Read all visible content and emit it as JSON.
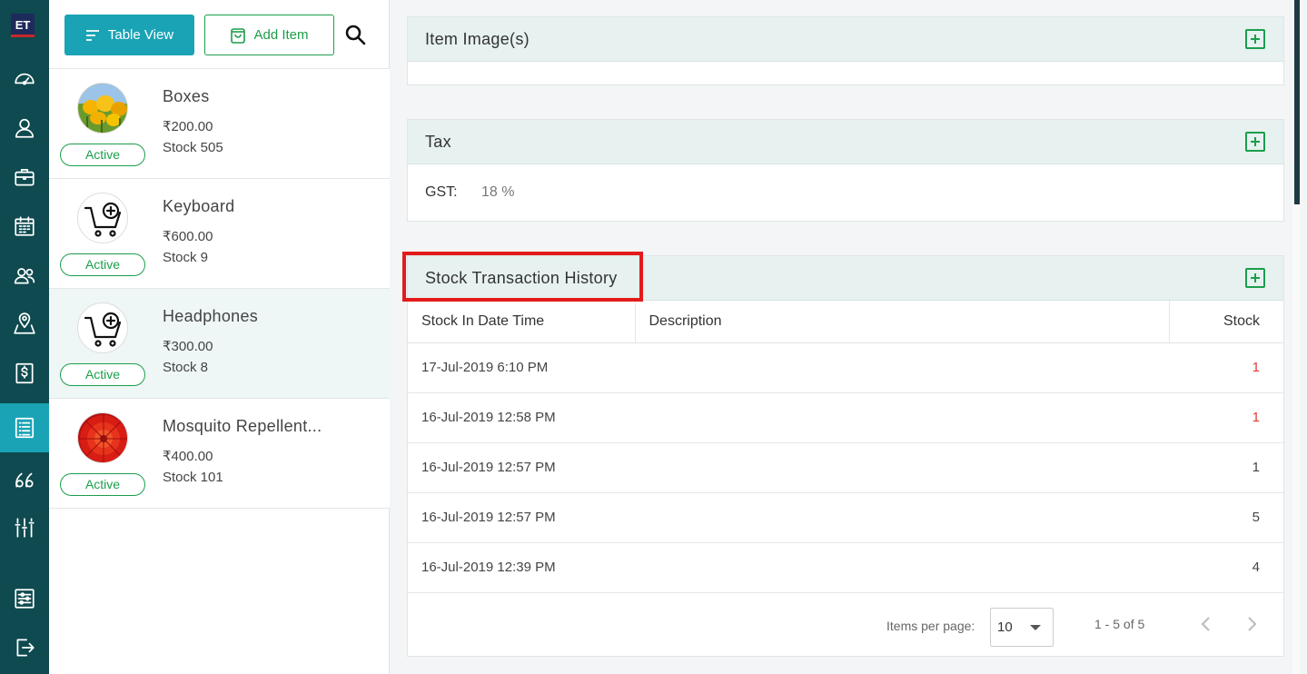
{
  "app": {
    "logo_text": "ET"
  },
  "rail": {
    "items": [
      {
        "icon": "dashboard-icon"
      },
      {
        "icon": "user-icon"
      },
      {
        "icon": "briefcase-icon"
      },
      {
        "icon": "calendar-icon"
      },
      {
        "icon": "users-icon"
      },
      {
        "icon": "map-pin-icon"
      },
      {
        "icon": "dollar-icon"
      },
      {
        "icon": "list-icon",
        "active": true
      },
      {
        "icon": "quote-icon"
      },
      {
        "icon": "sliders-icon"
      },
      {
        "icon": "settings-icon"
      },
      {
        "icon": "logout-icon"
      }
    ]
  },
  "toolbar": {
    "table_view_label": "Table View",
    "add_item_label": "Add Item"
  },
  "items": [
    {
      "name": "Boxes",
      "price": "₹200.00",
      "stock": "Stock 505",
      "status": "Active",
      "thumb": "yellow-flowers"
    },
    {
      "name": "Keyboard",
      "price": "₹600.00",
      "stock": "Stock 9",
      "status": "Active",
      "thumb": "cart"
    },
    {
      "name": "Headphones",
      "price": "₹300.00",
      "stock": "Stock 8",
      "status": "Active",
      "thumb": "cart",
      "selected": true
    },
    {
      "name": "Mosquito Repellent...",
      "price": "₹400.00",
      "stock": "Stock 101",
      "status": "Active",
      "thumb": "red-flower"
    }
  ],
  "sections": {
    "images": {
      "title": "Item Image(s)"
    },
    "tax": {
      "title": "Tax",
      "gst_label": "GST:",
      "gst_value": "18 %"
    },
    "stock": {
      "title": "Stock Transaction History",
      "columns": [
        "Stock In Date Time",
        "Description",
        "Stock"
      ],
      "rows": [
        {
          "datetime": "17-Jul-2019 6:10 PM",
          "description": "",
          "stock": "1",
          "highlight": true
        },
        {
          "datetime": "16-Jul-2019 12:58 PM",
          "description": "",
          "stock": "1",
          "highlight": true
        },
        {
          "datetime": "16-Jul-2019 12:57 PM",
          "description": "",
          "stock": "1"
        },
        {
          "datetime": "16-Jul-2019 12:57 PM",
          "description": "",
          "stock": "5"
        },
        {
          "datetime": "16-Jul-2019 12:39 PM",
          "description": "",
          "stock": "4"
        }
      ],
      "pager": {
        "items_per_page_label": "Items per page:",
        "page_size": "10",
        "range": "1 - 5 of 5"
      }
    }
  },
  "colors": {
    "rail_bg": "#0e4a4f",
    "accent": "#1aa3b5",
    "success": "#1b9e4b",
    "danger": "#e53935",
    "section_header": "#e6f1f0"
  }
}
